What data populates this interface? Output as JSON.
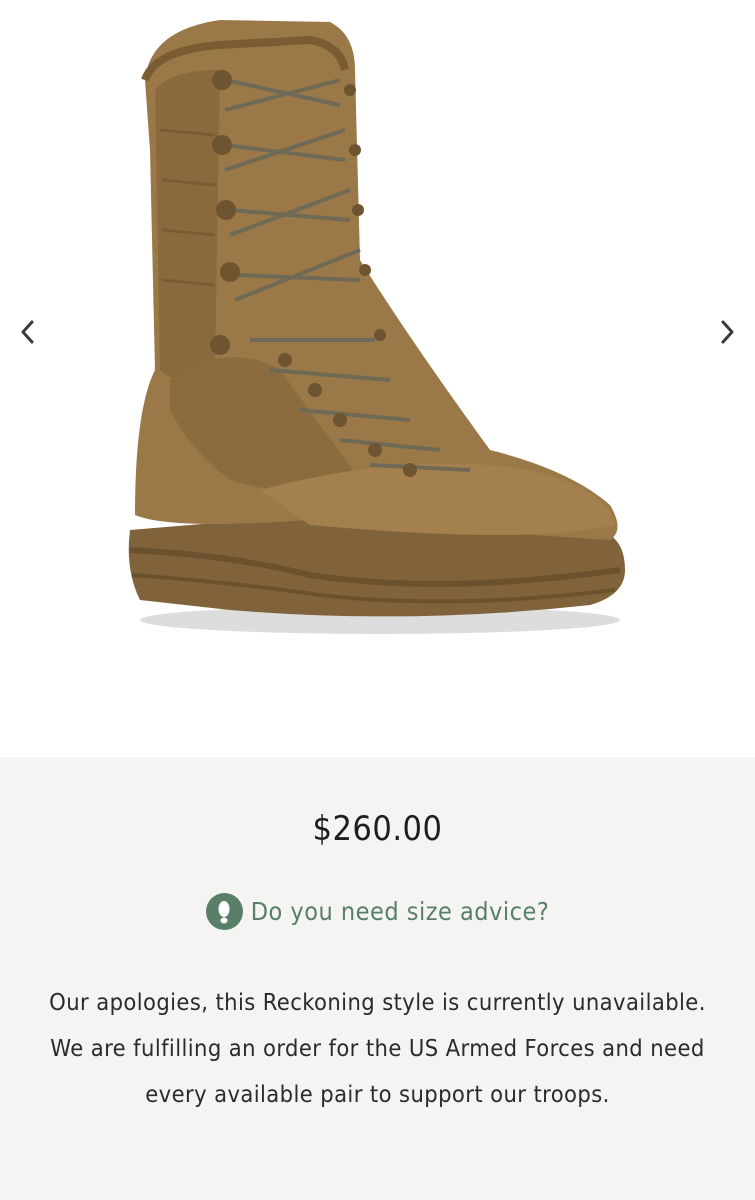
{
  "gallery": {
    "image_alt": "Reckoning boot in coyote brown",
    "prev_icon": "chevron-left-icon",
    "next_icon": "chevron-right-icon"
  },
  "product": {
    "price": "$260.00",
    "size_advice_label": "Do you need size advice?",
    "size_advice_icon": "footprint-icon",
    "unavailable_notice": "Our apologies, this Reckoning style is currently unavailable. We are fulfilling an order for the US Armed Forces and need every available pair to support our troops."
  },
  "colors": {
    "accent_green": "#5a7f68",
    "info_background": "#f4f4f2",
    "boot_brown": "#8a6a3c"
  }
}
